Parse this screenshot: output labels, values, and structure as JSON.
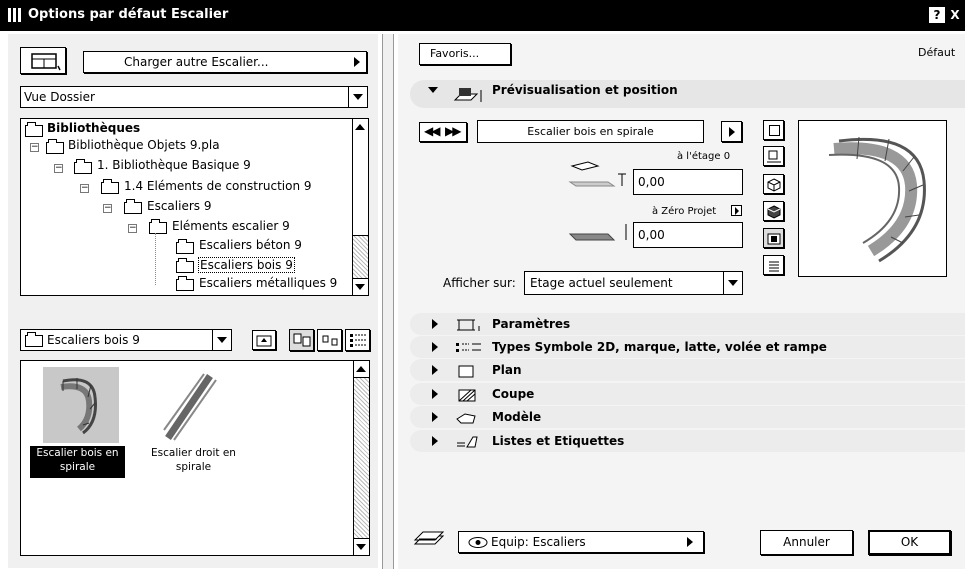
{
  "window": {
    "title": "Options par défaut Escalier",
    "help_btn": "?",
    "close_btn": "X"
  },
  "left": {
    "load_other": "Charger autre Escalier...",
    "view_mode": "Vue Dossier",
    "tree": [
      {
        "label": "Bibliothèques",
        "bold": true
      },
      {
        "label": "Bibliothèque Objets 9.pla"
      },
      {
        "label": "1. Bibliothèque Basique 9"
      },
      {
        "label": "1.4 Eléments de construction 9"
      },
      {
        "label": "Escaliers 9"
      },
      {
        "label": "Eléments escalier 9"
      },
      {
        "label": "Escaliers béton 9"
      },
      {
        "label": "Escaliers bois 9",
        "selected": true
      },
      {
        "label": "Escaliers métalliques 9"
      }
    ],
    "folder_select": "Escaliers bois 9",
    "items": [
      {
        "label_line1": "Escalier bois en",
        "label_line2": "spirale",
        "selected": true
      },
      {
        "label_line1": "Escalier droit en",
        "label_line2": "spirale"
      }
    ]
  },
  "right": {
    "favorites": "Favoris...",
    "default_label": "Défaut",
    "preview_section": "Prévisualisation et position",
    "object_name": "Escalier bois en spirale",
    "floor_label": "à l'étage 0",
    "floor_value": "0,00",
    "zero_label": "à Zéro Projet",
    "zero_value": "0,00",
    "show_on_label": "Afficher sur:",
    "show_on_value": "Etage actuel seulement",
    "sections": [
      {
        "label": "Paramètres"
      },
      {
        "label": "Types Symbole 2D, marque, latte, volée et rampe"
      },
      {
        "label": "Plan"
      },
      {
        "label": "Coupe"
      },
      {
        "label": "Modèle"
      },
      {
        "label": "Listes et Etiquettes"
      }
    ],
    "layer": "Equip: Escaliers",
    "cancel": "Annuler",
    "ok": "OK"
  }
}
